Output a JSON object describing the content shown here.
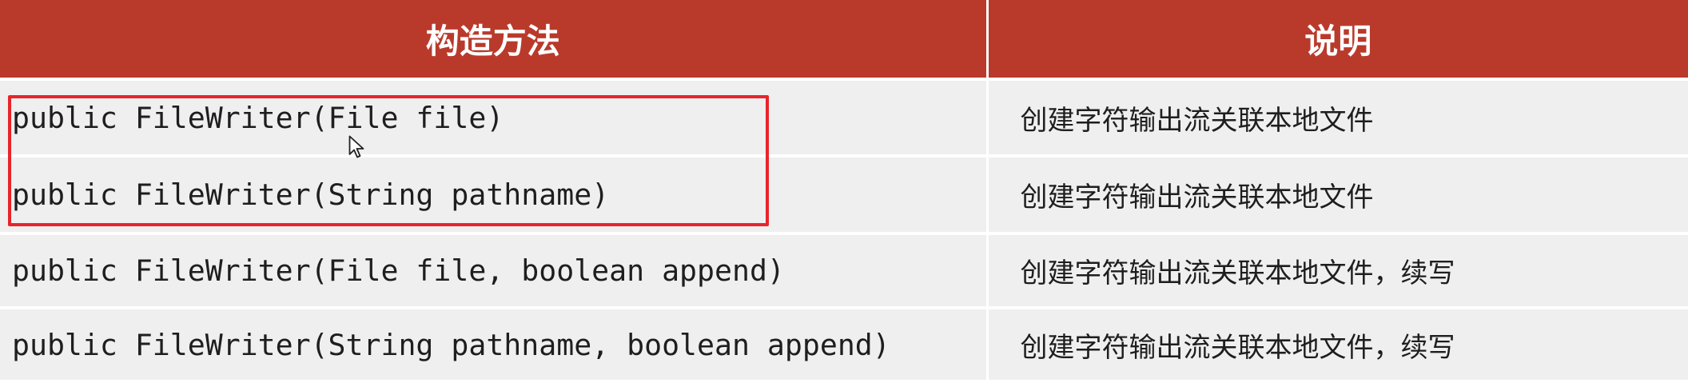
{
  "table": {
    "headers": [
      "构造方法",
      "说明"
    ],
    "rows": [
      {
        "method": "public FileWriter(File file)",
        "description": "创建字符输出流关联本地文件"
      },
      {
        "method": "public FileWriter(String pathname)",
        "description": "创建字符输出流关联本地文件"
      },
      {
        "method": "public FileWriter(File file, boolean append)",
        "description": "创建字符输出流关联本地文件，续写"
      },
      {
        "method": "public FileWriter(String pathname, boolean append)",
        "description": "创建字符输出流关联本地文件，续写"
      }
    ]
  },
  "colors": {
    "header_bg": "#b93a2b",
    "row_bg": "#efefef",
    "highlight": "#e8242b"
  },
  "icons": {
    "cursor": "mouse-pointer-icon"
  }
}
